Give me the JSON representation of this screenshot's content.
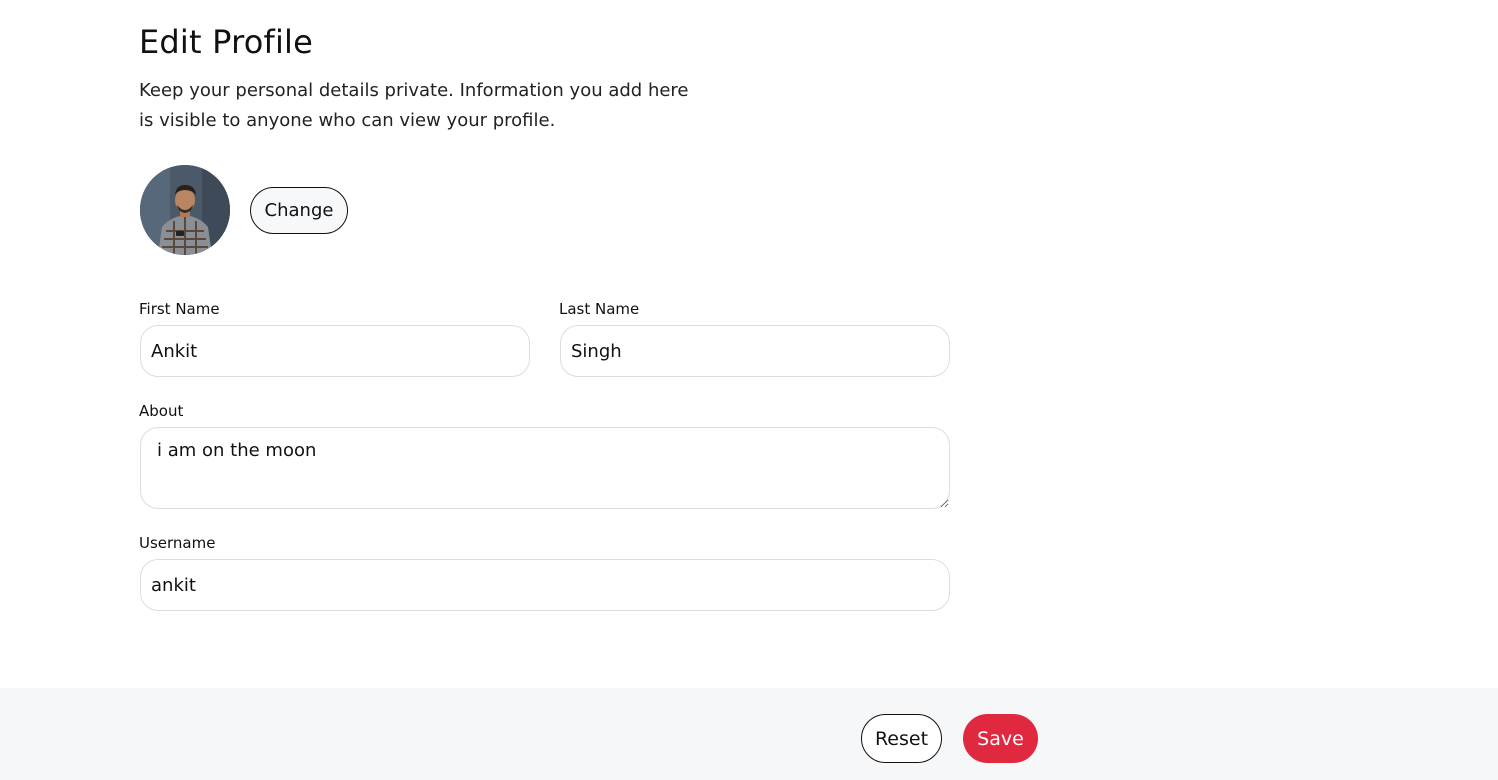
{
  "header": {
    "title": "Edit Profile",
    "subtitle": "Keep your personal details private. Information you add here is visible to anyone who can view your profile."
  },
  "avatar": {
    "icon": "profile-photo"
  },
  "change_button": {
    "label": "Change"
  },
  "form": {
    "first_name": {
      "label": "First Name",
      "value": "Ankit"
    },
    "last_name": {
      "label": "Last Name",
      "value": "Singh"
    },
    "about": {
      "label": "About",
      "value": "i am on the moon"
    },
    "username": {
      "label": "Username",
      "value": "ankit"
    }
  },
  "footer": {
    "reset_label": "Reset",
    "save_label": "Save"
  },
  "colors": {
    "accent": "#e0283f",
    "footer_bg": "#f6f7f9",
    "input_border": "#dcdde0"
  }
}
